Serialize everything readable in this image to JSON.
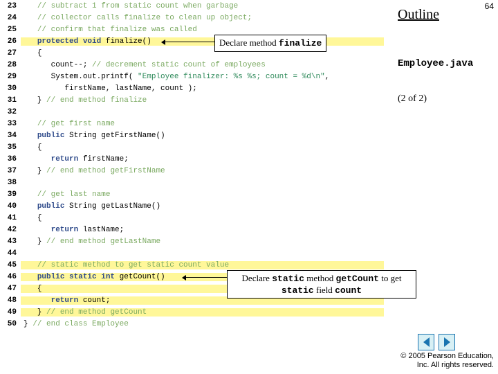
{
  "slidenum": "64",
  "outline": "Outline",
  "filename": "Employee.java",
  "pager": "(2 of  2)",
  "callout1_pre": "Declare method ",
  "callout1_mono": "finalize",
  "callout2_pre": "Declare ",
  "callout2_m1": "static",
  "callout2_mid": " method ",
  "callout2_m2": "getCount",
  "callout2_mid2": " to get ",
  "callout2_m3": "static",
  "callout2_mid3": " field ",
  "callout2_m4": "count",
  "footer1": "© 2005 Pearson Education,",
  "footer2": "Inc.  All rights reserved.",
  "lines": [
    {
      "n": "23",
      "bg": "g",
      "html": "   <span class='c-comment'>// subtract 1 from static count when garbage</span>"
    },
    {
      "n": "24",
      "bg": "g",
      "html": "   <span class='c-comment'>// collector calls finalize to clean up object;</span>"
    },
    {
      "n": "25",
      "bg": "g",
      "html": "   <span class='c-comment'>// confirm that finalize was called</span>"
    },
    {
      "n": "26",
      "bg": "y",
      "html": "   <span class='c-key'>protected void</span> <span class='c-plain'>finalize()</span>"
    },
    {
      "n": "27",
      "bg": "g",
      "html": "   <span class='c-plain'>{</span>"
    },
    {
      "n": "28",
      "bg": "g",
      "html": "      <span class='c-plain'>count--;</span> <span class='c-comment'>// decrement static count of employees</span>"
    },
    {
      "n": "29",
      "bg": "g",
      "html": "      <span class='c-plain'>System.out.printf(</span> <span class='c-str'>\"Employee finalizer: %s %s; count = %d\\n\"</span><span class='c-plain'>,</span>"
    },
    {
      "n": "30",
      "bg": "g",
      "html": "         <span class='c-plain'>firstName, lastName, count );</span>"
    },
    {
      "n": "31",
      "bg": "g",
      "html": "   <span class='c-plain'>}</span> <span class='c-comment'>// end method finalize</span>"
    },
    {
      "n": "32",
      "bg": "g",
      "html": ""
    },
    {
      "n": "33",
      "bg": "g",
      "html": "   <span class='c-comment'>// get first name</span>"
    },
    {
      "n": "34",
      "bg": "g",
      "html": "   <span class='c-key'>public</span> <span class='c-plain'>String getFirstName()</span>"
    },
    {
      "n": "35",
      "bg": "g",
      "html": "   <span class='c-plain'>{</span>"
    },
    {
      "n": "36",
      "bg": "g",
      "html": "      <span class='c-key'>return</span> <span class='c-plain'>firstName;</span>"
    },
    {
      "n": "37",
      "bg": "g",
      "html": "   <span class='c-plain'>}</span> <span class='c-comment'>// end method getFirstName</span>"
    },
    {
      "n": "38",
      "bg": "g",
      "html": ""
    },
    {
      "n": "39",
      "bg": "g",
      "html": "   <span class='c-comment'>// get last name</span>"
    },
    {
      "n": "40",
      "bg": "g",
      "html": "   <span class='c-key'>public</span> <span class='c-plain'>String getLastName()</span>"
    },
    {
      "n": "41",
      "bg": "g",
      "html": "   <span class='c-plain'>{</span>"
    },
    {
      "n": "42",
      "bg": "g",
      "html": "      <span class='c-key'>return</span> <span class='c-plain'>lastName;</span>"
    },
    {
      "n": "43",
      "bg": "g",
      "html": "   <span class='c-plain'>}</span> <span class='c-comment'>// end method getLastName</span>"
    },
    {
      "n": "44",
      "bg": "g",
      "html": ""
    },
    {
      "n": "45",
      "bg": "y",
      "html": "   <span class='c-comment'>// static method to get static count value</span>"
    },
    {
      "n": "46",
      "bg": "y",
      "html": "   <span class='c-key'>public static int</span> <span class='c-plain'>getCount()</span>"
    },
    {
      "n": "47",
      "bg": "y",
      "html": "   <span class='c-plain'>{</span>"
    },
    {
      "n": "48",
      "bg": "y",
      "html": "      <span class='c-key'>return</span> <span class='c-plain'>count;</span>"
    },
    {
      "n": "49",
      "bg": "y",
      "html": "   <span class='c-plain'>}</span> <span class='c-comment'>// end method getCount</span>"
    },
    {
      "n": "50",
      "bg": "g",
      "html": "<span class='c-plain'>}</span> <span class='c-comment'>// end class Employee</span>"
    }
  ]
}
